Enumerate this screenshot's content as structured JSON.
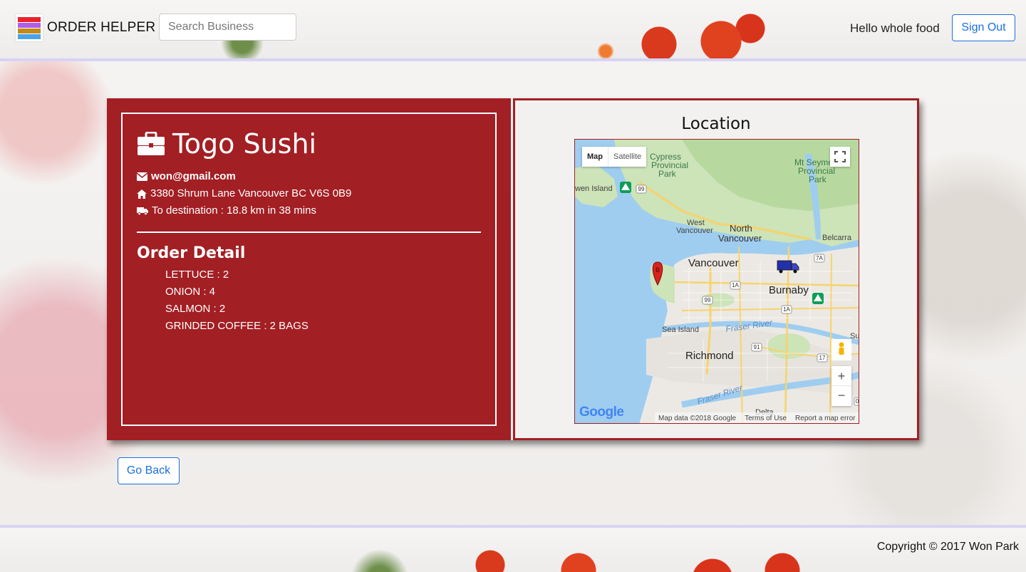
{
  "header": {
    "brand_name": "ORDER HELPER",
    "search_placeholder": "Search Business",
    "greeting": "Hello whole food",
    "signout_label": "Sign Out",
    "logo_colors": [
      "#e8232a",
      "#b05ee6",
      "#c08a1a",
      "#4aa3e8"
    ]
  },
  "business": {
    "name": "Togo Sushi",
    "email": "won@gmail.com",
    "address": "3380 Shrum Lane Vancouver BC V6S 0B9",
    "destination": "To destination : 18.8 km in 38 mins",
    "order_title": "Order Detail",
    "order_items": [
      "LETTUCE : 2",
      "ONION : 4",
      "SALMON : 2",
      "GRINDED COFFEE : 2 BAGS"
    ]
  },
  "location": {
    "title": "Location",
    "map": {
      "map_tab": "Map",
      "satellite_tab": "Satellite",
      "labels": {
        "cypress": "Cypress\nProvincial\nPark",
        "seymour": "Mt Seymour\nProvincial\nPark",
        "bowen": "wen Island",
        "west_van": "West\nVancouver",
        "north_van": "North\nVancouver",
        "belcarra": "Belcarra",
        "vancouver": "Vancouver",
        "burnaby": "Burnaby",
        "sea_island": "Sea Island",
        "fraser1": "Fraser River",
        "fraser2": "Fraser River",
        "richmond": "Richmond",
        "delta": "Delta",
        "surrey": "Sur",
        "r99a": "99",
        "r99b": "99",
        "r1a1": "1A",
        "r1a2": "1A",
        "r7a": "7A",
        "r91": "91",
        "r17": "17",
        "r0": "0"
      },
      "attribution": "Map data ©2018 Google",
      "terms": "Terms of Use",
      "report": "Report a map error",
      "google": "Google",
      "zoom_in": "+",
      "zoom_out": "−",
      "marker_letter": "B"
    }
  },
  "go_back_label": "Go Back",
  "footer": {
    "copyright": "Copyright © 2017 Won Park"
  },
  "colors": {
    "accent_red": "#a21f24",
    "link_blue": "#1b6fe0",
    "border_lavender": "#d7d3f3"
  }
}
